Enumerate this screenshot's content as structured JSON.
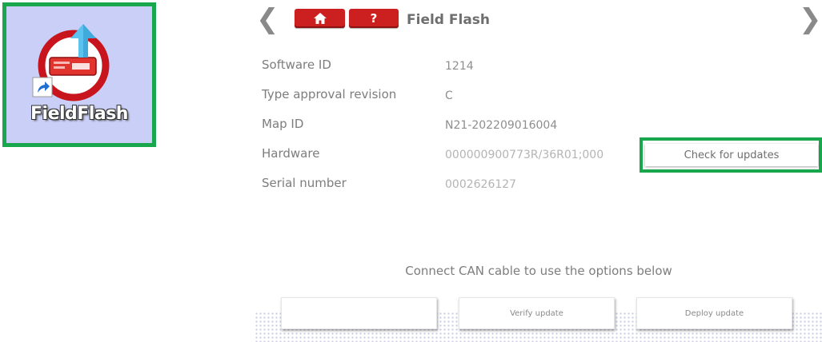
{
  "desktop_shortcut": {
    "label": "FieldFlash",
    "icon": "fieldflash-app-icon",
    "shortcut_badge": "shortcut-arrow-icon",
    "background": "#c9cff7",
    "highlight_color": "#18a74c"
  },
  "app": {
    "title": "Field Flash",
    "nav": {
      "prev_icon": "chevron-left-icon",
      "next_icon": "chevron-right-icon",
      "prev_glyph": "❮",
      "next_glyph": "❯"
    },
    "header_buttons": {
      "home_icon": "home-icon",
      "help_icon": "question-icon",
      "help_glyph": "?",
      "color": "#cc1f1f"
    },
    "info": [
      {
        "label": "Software ID",
        "value": "1214"
      },
      {
        "label": "Type approval revision",
        "value": "C"
      },
      {
        "label": "Map ID",
        "value": "N21-202209016004"
      },
      {
        "label": "Hardware",
        "value": "000000900773R/36R01;000"
      },
      {
        "label": "Serial number",
        "value": "0002626127"
      }
    ],
    "check_updates_label": "Check for updates",
    "can_notice": "Connect CAN cable to use the options below",
    "actions": [
      {
        "label": ""
      },
      {
        "label": "Verify update"
      },
      {
        "label": "Deploy update"
      }
    ],
    "highlight_color": "#18a74c"
  }
}
